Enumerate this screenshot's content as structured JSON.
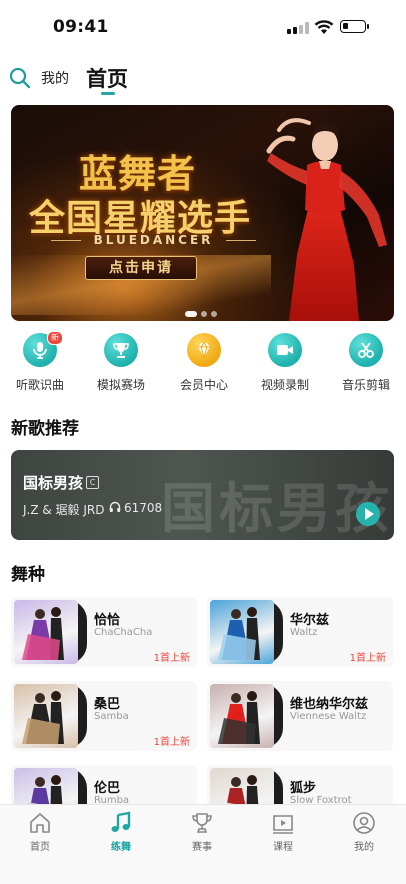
{
  "status_bar": {
    "time": "09:41"
  },
  "header": {
    "my_label": "我的",
    "title": "首页"
  },
  "banner": {
    "title_line1": "蓝舞者",
    "title_line2": "全国星耀选手",
    "brand": "BLUEDANCER",
    "cta": "点击申请",
    "pages": 3,
    "active_page": 0
  },
  "quick_menu": [
    {
      "label": "听歌识曲",
      "icon": "microphone-icon",
      "badge": "新"
    },
    {
      "label": "模拟赛场",
      "icon": "trophy-icon"
    },
    {
      "label": "会员中心",
      "icon": "diamond-icon"
    },
    {
      "label": "视频录制",
      "icon": "video-camera-icon"
    },
    {
      "label": "音乐剪辑",
      "icon": "scissors-icon"
    }
  ],
  "new_songs": {
    "title": "新歌推荐",
    "song": {
      "title": "国标男孩",
      "tag": "C",
      "artists": "J.Z & 琚毅 JRD",
      "plays": "61708",
      "watermark": "国标男孩"
    }
  },
  "dances": {
    "title": "舞种",
    "items": [
      {
        "name": "恰恰",
        "en": "ChaChaCha",
        "new": "1首上新"
      },
      {
        "name": "华尔兹",
        "en": "Waltz",
        "new": "1首上新"
      },
      {
        "name": "桑巴",
        "en": "Samba",
        "new": "1首上新"
      },
      {
        "name": "维也纳华尔兹",
        "en": "Viennese Waltz",
        "new": ""
      },
      {
        "name": "伦巴",
        "en": "Rumba",
        "new": ""
      },
      {
        "name": "狐步",
        "en": "Slow Foxtrot",
        "new": ""
      }
    ]
  },
  "tab_bar": [
    {
      "label": "首页",
      "icon": "home-icon",
      "active": false
    },
    {
      "label": "练舞",
      "icon": "music-note-icon",
      "active": true
    },
    {
      "label": "赛事",
      "icon": "trophy-icon",
      "active": false
    },
    {
      "label": "课程",
      "icon": "course-icon",
      "active": false
    },
    {
      "label": "我的",
      "icon": "user-icon",
      "active": false
    }
  ],
  "colors": {
    "accent": "#27a5a3",
    "new_badge": "#e9453a",
    "gold": "#f0a912"
  }
}
